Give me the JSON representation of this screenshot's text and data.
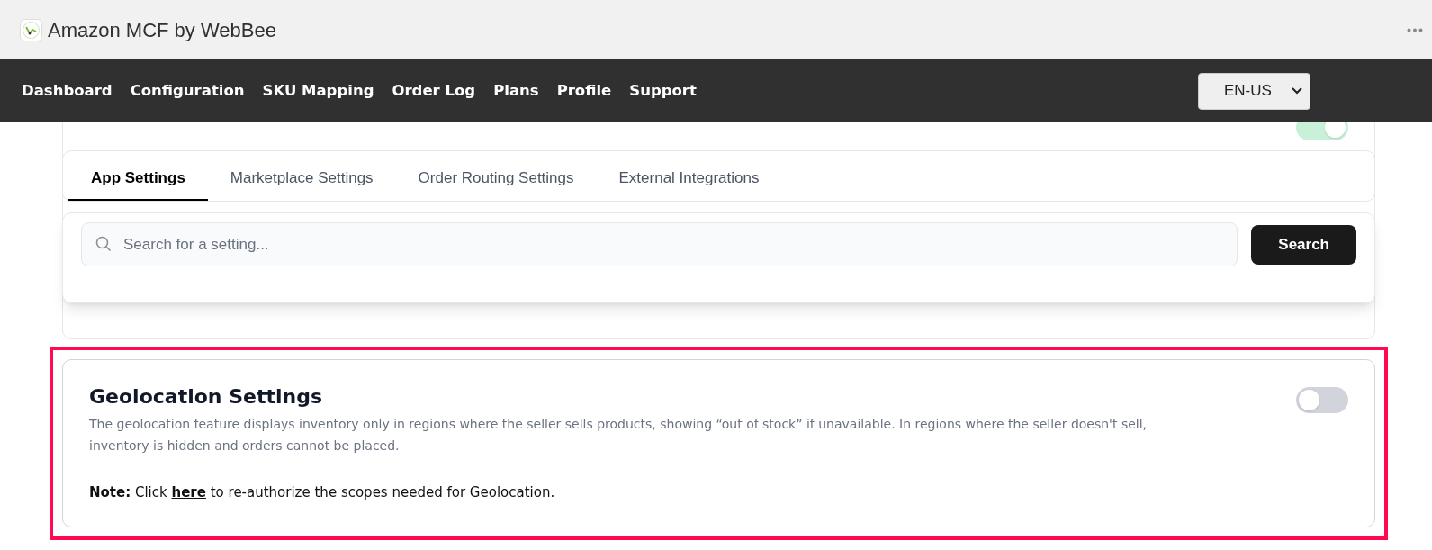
{
  "app": {
    "title": "Amazon MCF by WebBee"
  },
  "nav": {
    "items": [
      {
        "label": "Dashboard"
      },
      {
        "label": "Configuration"
      },
      {
        "label": "SKU Mapping"
      },
      {
        "label": "Order Log"
      },
      {
        "label": "Plans"
      },
      {
        "label": "Profile"
      },
      {
        "label": "Support"
      }
    ],
    "language": "EN-US"
  },
  "background_cards": [
    {
      "on": true
    }
  ],
  "tabs": [
    {
      "label": "App Settings",
      "selected": true
    },
    {
      "label": "Marketplace Settings",
      "selected": false
    },
    {
      "label": "Order Routing Settings",
      "selected": false
    },
    {
      "label": "External Integrations",
      "selected": false
    }
  ],
  "search": {
    "placeholder": "Search for a setting...",
    "button": "Search"
  },
  "geolocation": {
    "title": "Geolocation Settings",
    "description": "The geolocation feature displays inventory only in regions where the seller sells products, showing “out of stock” if unavailable. In regions where the seller doesn't sell, inventory is hidden and orders cannot be placed.",
    "on": false,
    "highlighted": true,
    "note": {
      "before": "**Note:** Click",
      "link": "here",
      "after": "to re-authorize the scopes needed for Geolocation."
    }
  }
}
